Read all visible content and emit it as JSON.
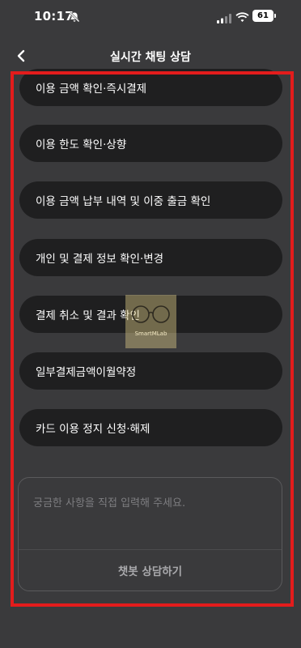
{
  "status_bar": {
    "time": "10:17",
    "battery": "61"
  },
  "header": {
    "title": "실시간 채팅 상담"
  },
  "menu": {
    "items": [
      "이용 금액 확인·즉시결제",
      "이용 한도 확인·상향",
      "이용 금액 납부 내역 및 이중 출금 확인",
      "개인 및 결제 정보 확인·변경",
      "결제 취소 및 결과 확인",
      "일부결제금액이월약정",
      "카드 이용 정지 신청·해제"
    ]
  },
  "input": {
    "placeholder": "궁금한 사항을 직접 입력해 주세요.",
    "value": "",
    "chatbot_button_label": "챗봇 상담하기"
  },
  "watermark": {
    "text": "SmartMLab"
  },
  "colors": {
    "background": "#3a3a3c",
    "button": "#1f1f20",
    "highlight": "#e31c1c"
  }
}
